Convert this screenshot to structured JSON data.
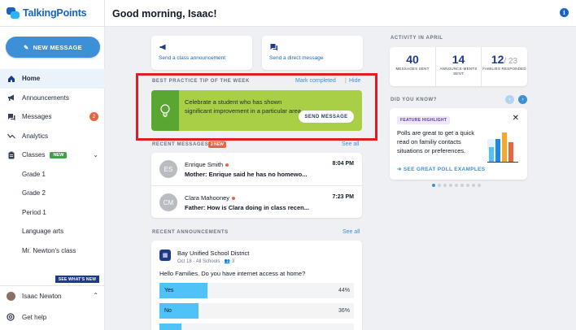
{
  "app": {
    "name": "TalkingPoints"
  },
  "sidebar": {
    "new_message_label": "NEW MESSAGE",
    "items": [
      {
        "label": "Home",
        "icon": "home-icon"
      },
      {
        "label": "Announcements",
        "icon": "megaphone-icon"
      },
      {
        "label": "Messages",
        "icon": "chat-icon",
        "count": "2"
      },
      {
        "label": "Analytics",
        "icon": "trend-icon"
      },
      {
        "label": "Classes",
        "icon": "clipboard-icon",
        "badge": "NEW"
      }
    ],
    "classes": [
      "Grade 1",
      "Grade 2",
      "Period 1",
      "Language arts",
      "Mr. Newton's class"
    ],
    "see_whats_new": "SEE WHAT'S NEW",
    "user_name": "Isaac Newton",
    "help_label": "Get help"
  },
  "header": {
    "greeting": "Good morning, Isaac!"
  },
  "actions": {
    "class_announcement": "Send a class announcement",
    "direct_message": "Send a direct message"
  },
  "tip": {
    "section_label": "BEST PRACTICE TIP OF THE WEEK",
    "mark_completed": "Mark completed",
    "separator": "|",
    "hide": "Hide",
    "text": "Celebrate a student who has shown significant improvement in a particular area.",
    "button": "SEND MESSAGE"
  },
  "recent_messages": {
    "section_label": "RECENT MESSAGES",
    "badge": "2 NEW",
    "see_all": "See all",
    "items": [
      {
        "initials": "ES",
        "name": "Enrique Smith",
        "preview": "Mother: Enrique said he has no homewo...",
        "time": "8:04 PM"
      },
      {
        "initials": "CM",
        "name": "Clara Mahooney",
        "preview": "Father: How is Clara doing in class recen...",
        "time": "7:23 PM"
      }
    ]
  },
  "recent_announcements": {
    "section_label": "RECENT ANNOUNCEMENTS",
    "see_all": "See all",
    "school": "Bay Unified School District",
    "meta": "Oct 18 · All Schools · 👥 3",
    "question": "Hello Families. Do you have internet access at home?",
    "poll": [
      {
        "label": "Yes",
        "pct": "44%",
        "fraction": 0.44
      },
      {
        "label": "No",
        "pct": "36%",
        "fraction": 0.36
      },
      {
        "label": "",
        "pct": "",
        "fraction": 0.2
      }
    ]
  },
  "activity": {
    "section_label": "ACTIVITY IN APRIL",
    "stats": [
      {
        "value": "40",
        "label": "MESSAGES SENT"
      },
      {
        "value": "14",
        "label": "ANNOUNCE-MENTS SENT"
      },
      {
        "value": "12",
        "denominator": "/ 23",
        "label": "FAMILIES RESPONDED"
      }
    ]
  },
  "did_you_know": {
    "section_label": "DID YOU KNOW?",
    "tag": "FEATURE HIGHLIGHT",
    "text": "Polls are great to get a quick read on familiy contacts situations or preferences.",
    "link": "SEE GREAT POLL EXAMPLES",
    "dots_total": 9,
    "dots_active": 1
  },
  "colors": {
    "accent": "#3d8fd8",
    "tip_green": "#a8cf45",
    "highlight_red": "#e31b23",
    "badge_orange": "#e8663f"
  }
}
